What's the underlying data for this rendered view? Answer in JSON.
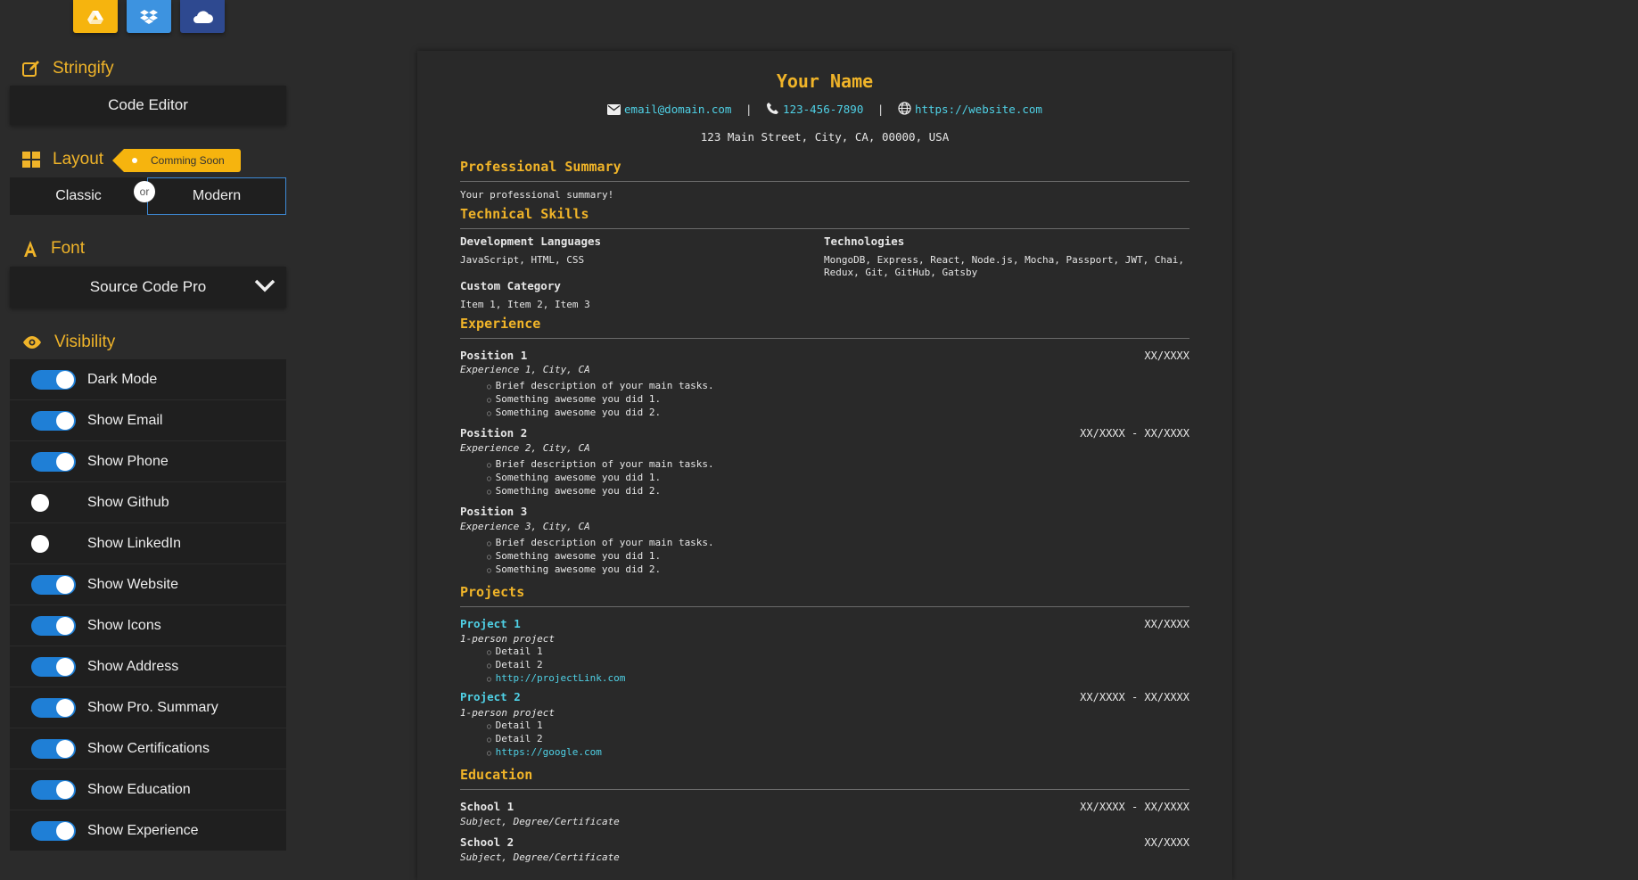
{
  "colors": {
    "accent": "#f0b429",
    "toggle_on": "#1f7fd6",
    "link": "#4fd1e6"
  },
  "top_icons": [
    "google-drive-icon",
    "dropbox-icon",
    "cloud-icon"
  ],
  "sidebar": {
    "stringify": {
      "title": "Stringify",
      "button": "Code Editor"
    },
    "layout": {
      "title": "Layout",
      "badge": "Comming Soon",
      "options": [
        "Classic",
        "Modern"
      ],
      "or": "or",
      "selected": "Modern"
    },
    "font": {
      "title": "Font",
      "selected": "Source Code Pro"
    },
    "visibility": {
      "title": "Visibility",
      "items": [
        {
          "label": "Dark Mode",
          "on": true
        },
        {
          "label": "Show Email",
          "on": true
        },
        {
          "label": "Show Phone",
          "on": true
        },
        {
          "label": "Show Github",
          "on": false
        },
        {
          "label": "Show LinkedIn",
          "on": false
        },
        {
          "label": "Show Website",
          "on": true
        },
        {
          "label": "Show Icons",
          "on": true
        },
        {
          "label": "Show Address",
          "on": true
        },
        {
          "label": "Show Pro. Summary",
          "on": true
        },
        {
          "label": "Show Certifications",
          "on": true
        },
        {
          "label": "Show Education",
          "on": true
        },
        {
          "label": "Show Experience",
          "on": true
        }
      ]
    }
  },
  "resume": {
    "name": "Your Name",
    "email": "email@domain.com",
    "phone": "123-456-7890",
    "website": "https://website.com",
    "separator": "|",
    "address": "123 Main Street, City, CA, 00000, USA",
    "summary": {
      "title": "Professional Summary",
      "text": "Your professional summary!"
    },
    "skills": {
      "title": "Technical Skills",
      "groups": [
        {
          "name": "Development Languages",
          "items": "JavaScript, HTML, CSS"
        },
        {
          "name": "Technologies",
          "items_line1": "MongoDB, Express, React, Node.js, Mocha, Passport, JWT, Chai,",
          "items_line2": "Redux, Git, GitHub, Gatsby"
        },
        {
          "name": "Custom Category",
          "items": "Item 1, Item 2, Item 3"
        }
      ]
    },
    "experience": {
      "title": "Experience",
      "positions": [
        {
          "title": "Position 1",
          "sub": "Experience 1, City, CA",
          "date": "XX/XXXX",
          "bullets": [
            "Brief description of your main tasks.",
            "Something awesome you did 1.",
            "Something awesome you did 2."
          ]
        },
        {
          "title": "Position 2",
          "sub": "Experience 2, City, CA",
          "date": "XX/XXXX - XX/XXXX",
          "bullets": [
            "Brief description of your main tasks.",
            "Something awesome you did 1.",
            "Something awesome you did 2."
          ]
        },
        {
          "title": "Position 3",
          "sub": "Experience 3, City, CA",
          "date": "",
          "bullets": [
            "Brief description of your main tasks.",
            "Something awesome you did 1.",
            "Something awesome you did 2."
          ]
        }
      ]
    },
    "projects": {
      "title": "Projects",
      "items": [
        {
          "title": "Project 1",
          "sub": "1-person project",
          "date": "XX/XXXX",
          "details": [
            "Detail 1",
            "Detail 2"
          ],
          "link": "http://projectLink.com"
        },
        {
          "title": "Project 2",
          "sub": "1-person project",
          "date": "XX/XXXX - XX/XXXX",
          "details": [
            "Detail 1",
            "Detail 2"
          ],
          "link": "https://google.com"
        }
      ]
    },
    "education": {
      "title": "Education",
      "items": [
        {
          "title": "School 1",
          "sub": "Subject, Degree/Certificate",
          "date": "XX/XXXX - XX/XXXX"
        },
        {
          "title": "School 2",
          "sub": "Subject, Degree/Certificate",
          "date": "XX/XXXX"
        }
      ]
    }
  }
}
